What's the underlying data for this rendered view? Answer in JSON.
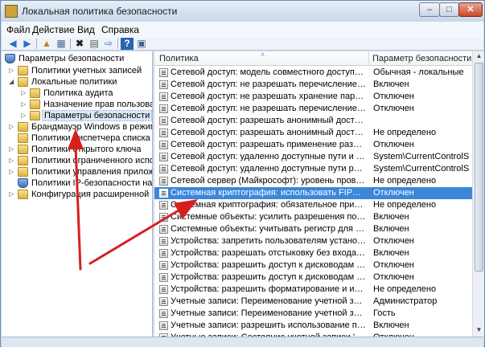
{
  "window": {
    "title": "Локальная политика безопасности",
    "controls": {
      "minimize": "–",
      "maximize": "□",
      "close": "✕"
    }
  },
  "menu": {
    "items": [
      "Файл",
      "Действие",
      "Вид",
      "Справка"
    ]
  },
  "toolbar": {
    "icons": [
      "back-arrow-icon",
      "forward-arrow-icon",
      "up-folder-icon",
      "show-tree-icon",
      "delete-icon",
      "properties-icon",
      "export-icon",
      "help-icon",
      "console-icon"
    ]
  },
  "tree": {
    "root": "Параметры безопасности",
    "items": [
      {
        "label": "Политики учетных записей",
        "level": 1,
        "expanded": false
      },
      {
        "label": "Локальные политики",
        "level": 1,
        "expanded": true
      },
      {
        "label": "Политика аудита",
        "level": 2,
        "expanded": false
      },
      {
        "label": "Назначение прав пользователя",
        "level": 2,
        "expanded": false
      },
      {
        "label": "Параметры безопасности",
        "level": 2,
        "expanded": false,
        "selected": true
      },
      {
        "label": "Брандмауэр Windows в режиме пов",
        "level": 1,
        "expanded": false
      },
      {
        "label": "Политики диспетчера списка сетей",
        "level": 1
      },
      {
        "label": "Политики открытого ключа",
        "level": 1,
        "expanded": false
      },
      {
        "label": "Политики ограниченного использова",
        "level": 1,
        "expanded": false
      },
      {
        "label": "Политики управления приложения",
        "level": 1,
        "expanded": false
      },
      {
        "label": "Политики IP-безопасности на \"Лока",
        "level": 1
      },
      {
        "label": "Конфигурация расширенной полит",
        "level": 1,
        "expanded": false
      }
    ]
  },
  "table": {
    "columns": [
      "Политика",
      "Параметр безопасности"
    ],
    "rows": [
      {
        "policy": "Сетевой доступ: модель совместного доступа и безопас...",
        "value": "Обычная - локальные"
      },
      {
        "policy": "Сетевой доступ: не разрешать перечисление учетных зап...",
        "value": "Включен"
      },
      {
        "policy": "Сетевой доступ: не разрешать хранение паролей или уче...",
        "value": "Отключен"
      },
      {
        "policy": "Сетевой доступ: не разрешать перечисление учетных зап...",
        "value": "Отключен"
      },
      {
        "policy": "Сетевой доступ: разрешать анонимный доступ к именов...",
        "value": ""
      },
      {
        "policy": "Сетевой доступ: разрешать анонимный доступ к общим ...",
        "value": "Не определено"
      },
      {
        "policy": "Сетевой доступ: разрешать применение разрешений \"Дл...",
        "value": "Отключен"
      },
      {
        "policy": "Сетевой доступ: удаленно доступные пути и вложенные ...",
        "value": "System\\CurrentControlS..."
      },
      {
        "policy": "Сетевой доступ: удаленно доступные пути реестра",
        "value": "System\\CurrentControlS..."
      },
      {
        "policy": "Сетевой сервер (Майкрософт): уровень проверки сервер...",
        "value": "Не определено"
      },
      {
        "policy": "Системная криптография: использовать FIPS-совместим...",
        "value": "Отключен",
        "selected": true
      },
      {
        "policy": "Системная криптография: обязательное применение сил...",
        "value": "Не определено"
      },
      {
        "policy": "Системные объекты: усилить разрешения по умолчани...",
        "value": "Включен"
      },
      {
        "policy": "Системные объекты: учитывать регистр для подсистем, ...",
        "value": "Включен"
      },
      {
        "policy": "Устройства: запретить пользователям установку драйвер...",
        "value": "Отключен"
      },
      {
        "policy": "Устройства: разрешать отстыковку без входа в систему",
        "value": "Включен"
      },
      {
        "policy": "Устройства: разрешить доступ к дисководам гибких диск...",
        "value": "Отключен"
      },
      {
        "policy": "Устройства: разрешить доступ к дисководам компакт-ди...",
        "value": "Отключен"
      },
      {
        "policy": "Устройства: разрешить форматирование и извлечение с...",
        "value": "Не определено"
      },
      {
        "policy": "Учетные записи: Переименование учетной записи адми...",
        "value": "Администратор"
      },
      {
        "policy": "Учетные записи: Переименование учетной записи гостя",
        "value": "Гость"
      },
      {
        "policy": "Учетные записи: разрешить использование пустых пар...",
        "value": "Включен"
      },
      {
        "policy": "Учетные записи: Состояние учетной записи 'Администра...",
        "value": "Отключен"
      }
    ]
  },
  "colors": {
    "selection": "#3b87d9",
    "arrow": "#d62020"
  }
}
